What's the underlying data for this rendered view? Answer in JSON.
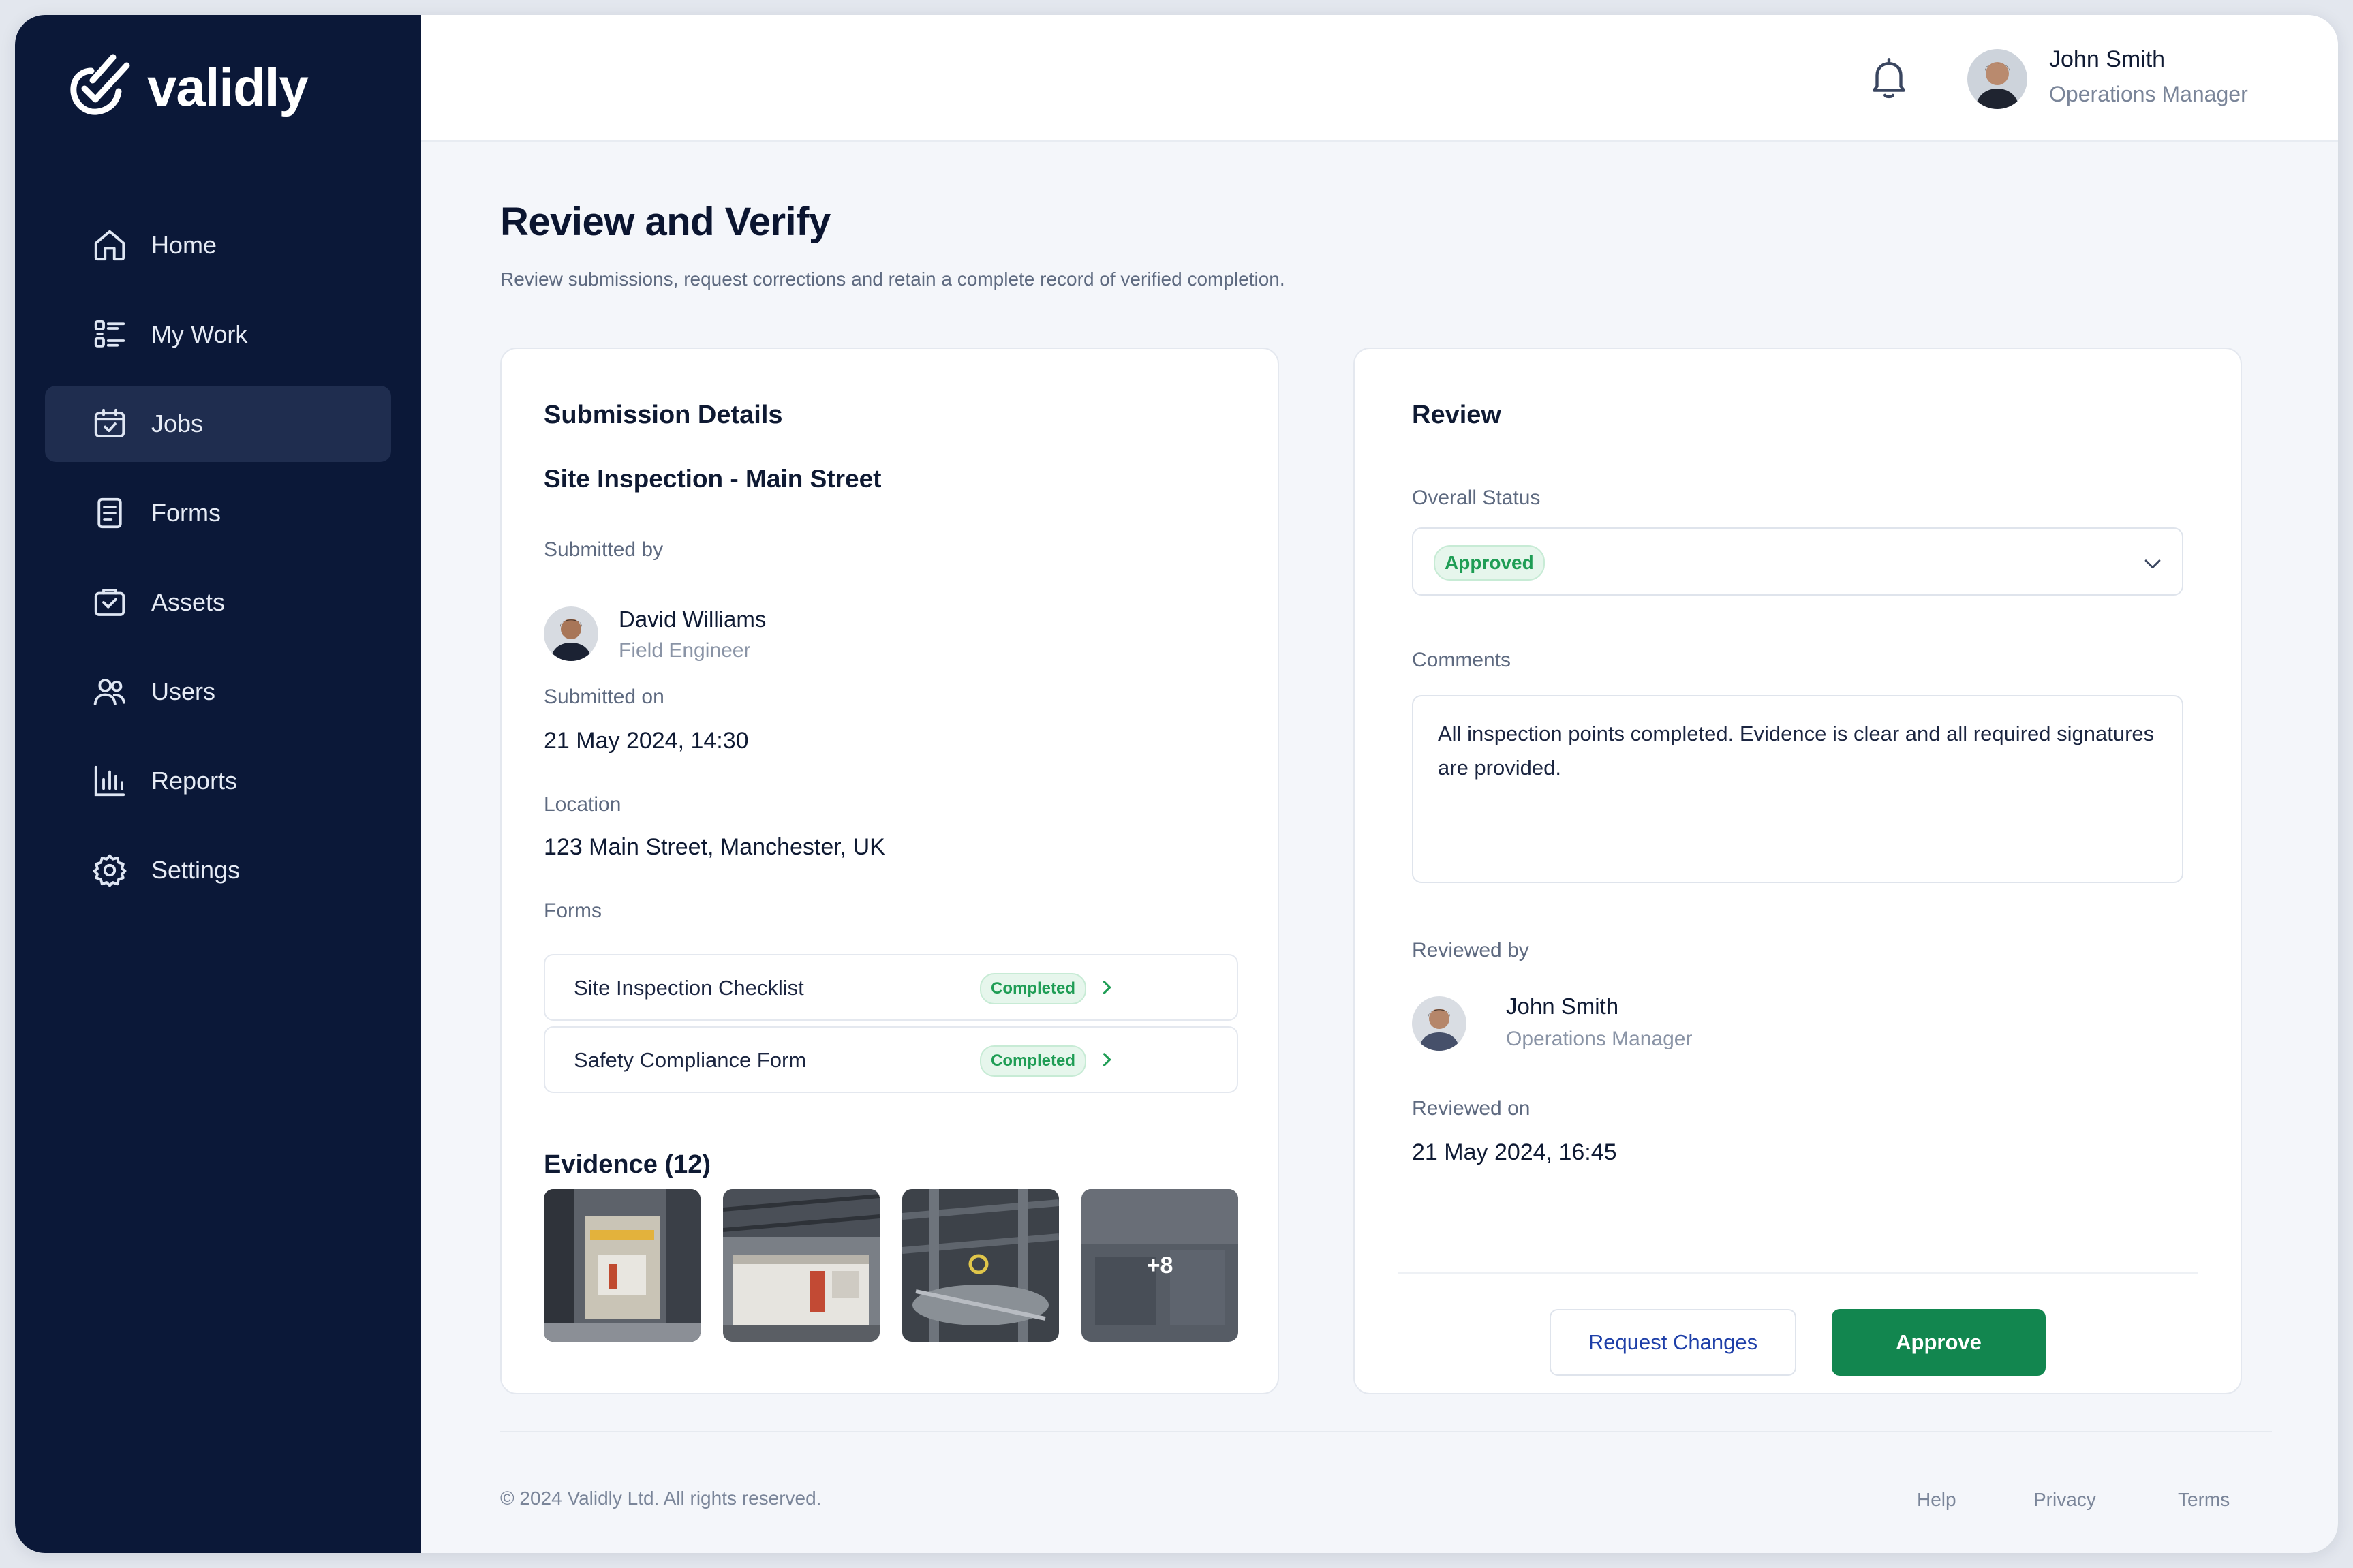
{
  "app": {
    "brand": "validly"
  },
  "sidebar": {
    "items": [
      {
        "label": "Home",
        "icon": "home-icon",
        "active": false
      },
      {
        "label": "My Work",
        "icon": "checklist-icon",
        "active": false
      },
      {
        "label": "Jobs",
        "icon": "jobs-icon",
        "active": true
      },
      {
        "label": "Forms",
        "icon": "form-icon",
        "active": false
      },
      {
        "label": "Assets",
        "icon": "assets-icon",
        "active": false
      },
      {
        "label": "Users",
        "icon": "users-icon",
        "active": false
      },
      {
        "label": "Reports",
        "icon": "bar-chart-icon",
        "active": false
      },
      {
        "label": "Settings",
        "icon": "gear-icon",
        "active": false
      }
    ]
  },
  "header": {
    "user_name": "John Smith",
    "user_role": "Operations Manager"
  },
  "page": {
    "title": "Review and Verify",
    "subtitle": "Review submissions, request corrections and retain a complete record of verified completion."
  },
  "submission": {
    "heading": "Submission Details",
    "job_title": "Site Inspection - Main Street",
    "submitted_by_label": "Submitted by",
    "submitter_name": "David Williams",
    "submitter_role": "Field Engineer",
    "submitted_on_label": "Submitted on",
    "submitted_on": "21 May 2024, 14:30",
    "location_label": "Location",
    "location": "123 Main Street, Manchester, UK",
    "forms_label": "Forms",
    "forms": [
      {
        "name": "Site Inspection Checklist",
        "status": "Completed"
      },
      {
        "name": "Safety Compliance Form",
        "status": "Completed"
      }
    ],
    "evidence_label": "Evidence (12)",
    "evidence_more": "+8"
  },
  "review": {
    "heading": "Review",
    "overall_status_label": "Overall Status",
    "overall_status": "Approved",
    "comments_label": "Comments",
    "comments": "All inspection points completed. Evidence is clear and all required signatures are provided.",
    "reviewed_by_label": "Reviewed by",
    "reviewer_name": "John Smith",
    "reviewer_role": "Operations Manager",
    "reviewed_on_label": "Reviewed on",
    "reviewed_on": "21 May 2024, 16:45",
    "request_changes_label": "Request Changes",
    "approve_label": "Approve"
  },
  "footer": {
    "copyright": "© 2024 Validly Ltd. All rights reserved.",
    "links": [
      "Help",
      "Privacy",
      "Terms"
    ]
  },
  "colors": {
    "sidebar_bg": "#0b1838",
    "accent_green": "#12864f",
    "link_blue": "#1e3fa8"
  }
}
